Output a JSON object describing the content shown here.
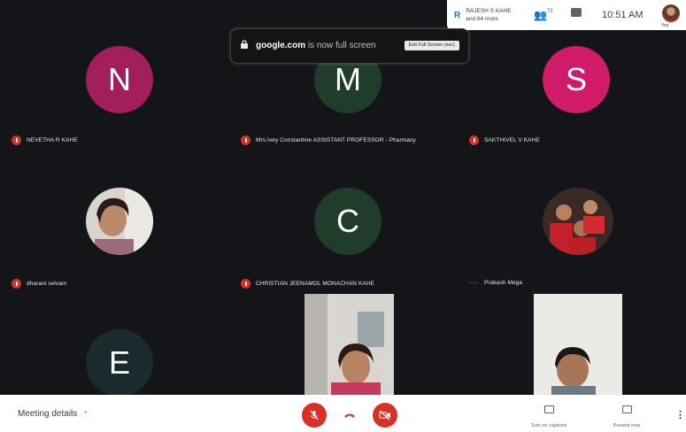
{
  "topbar": {
    "speaker_name": "RAJESH S KAHE",
    "speaker_more": "and 64 more",
    "people_count": "73",
    "time": "10:51 AM",
    "self_label": "You"
  },
  "fullscreen_banner": {
    "domain": "google.com",
    "message": " is now full screen",
    "exit_label": "Exit Full Screen (esc)"
  },
  "participants": [
    {
      "initial": "N",
      "color": "#a31f5b",
      "name": "NEVETHA R KAHE",
      "muted": true
    },
    {
      "initial": "M",
      "color": "#1f3d2a",
      "name": "Mrs.Ivey Constantine ASSISTANT PROFESSOR - Pharmacy",
      "muted": true
    },
    {
      "initial": "S",
      "color": "#d01a6a",
      "name": "SAKTHIVEL V KAHE",
      "muted": true
    },
    {
      "initial": "",
      "color": "",
      "name": "dharani selvam",
      "muted": true
    },
    {
      "initial": "C",
      "color": "#1f3d2a",
      "name": "CHRISTIAN JEENAMOL MONACHAN KAHE",
      "muted": true
    },
    {
      "initial": "",
      "color": "",
      "name": "Prakash Mega",
      "muted": false
    },
    {
      "initial": "E",
      "color": "#1b2a2c",
      "name": "",
      "muted": false
    }
  ],
  "bottombar": {
    "meeting_details": "Meeting details",
    "captions_label": "Turn on captions",
    "present_label": "Present now"
  },
  "colors": {
    "stage_bg": "#131518",
    "danger": "#d93025"
  },
  "icons": [
    "lock-icon",
    "people-icon",
    "chat-icon",
    "mic-off-icon",
    "hangup-icon",
    "camera-off-icon",
    "captions-icon",
    "present-icon",
    "more-vert-icon"
  ]
}
